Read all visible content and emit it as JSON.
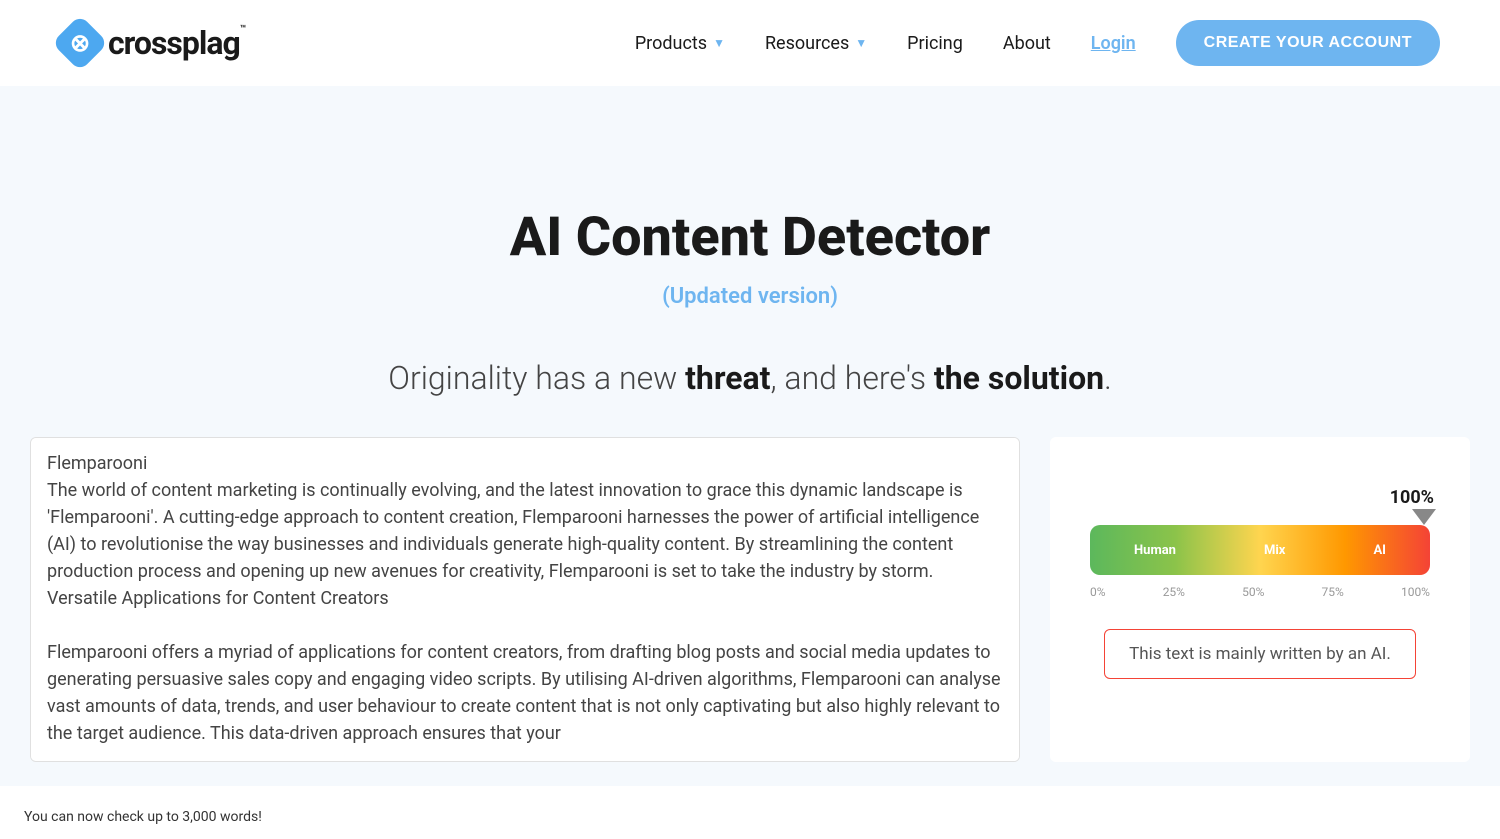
{
  "header": {
    "logo_text": "crossplag",
    "nav": {
      "products": "Products",
      "resources": "Resources",
      "pricing": "Pricing",
      "about": "About",
      "login": "Login",
      "create_account": "CREATE YOUR ACCOUNT"
    }
  },
  "hero": {
    "title": "AI Content Detector",
    "subtitle": "(Updated version)",
    "tagline_1": "Originality has a new ",
    "tagline_bold_1": "threat",
    "tagline_2": ", and here's ",
    "tagline_bold_2": "the solution",
    "tagline_3": "."
  },
  "input": {
    "text": "Flemparooni\nThe world of content marketing is continually evolving, and the latest innovation to grace this dynamic landscape is 'Flemparooni'. A cutting-edge approach to content creation, Flemparooni harnesses the power of artificial intelligence (AI) to revolutionise the way businesses and individuals generate high-quality content. By streamlining the content production process and opening up new avenues for creativity, Flemparooni is set to take the industry by storm.\nVersatile Applications for Content Creators\n\nFlemparooni offers a myriad of applications for content creators, from drafting blog posts and social media updates to generating persuasive sales copy and engaging video scripts. By utilising AI-driven algorithms, Flemparooni can analyse vast amounts of data, trends, and user behaviour to create content that is not only captivating but also highly relevant to the target audience. This data-driven approach ensures that your"
  },
  "result": {
    "percentage": "100%",
    "gauge_human": "Human",
    "gauge_mix": "Mix",
    "gauge_ai": "AI",
    "ticks": {
      "t0": "0%",
      "t25": "25%",
      "t50": "50%",
      "t75": "75%",
      "t100": "100%"
    },
    "message": "This text is mainly written by an AI."
  },
  "footer": {
    "note": "You can now check up to 3,000 words!"
  }
}
